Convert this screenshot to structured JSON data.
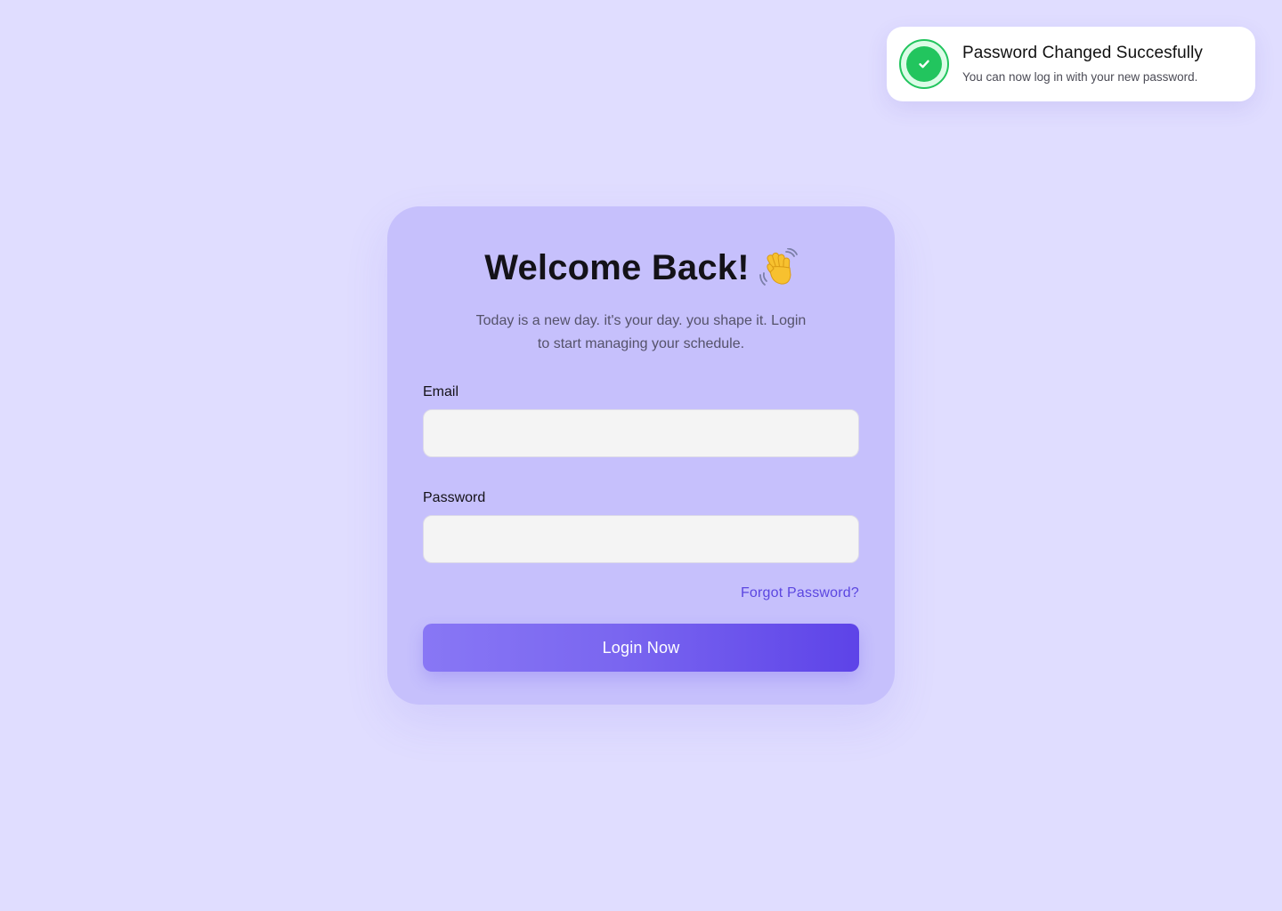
{
  "toast": {
    "icon": "check-icon",
    "title": "Password Changed Succesfully",
    "message": "You can now log in with your new password.",
    "status_color": "#22c55e"
  },
  "login": {
    "title": "Welcome Back!",
    "title_icon": "waving-hand-icon",
    "subtitle": "Today is a new day. it's your day. you shape it. Login to start managing your schedule.",
    "email": {
      "label": "Email",
      "value": "",
      "placeholder": ""
    },
    "password": {
      "label": "Password",
      "value": "",
      "placeholder": ""
    },
    "forgot_password": "Forgot Password?",
    "submit_label": "Login Now"
  },
  "colors": {
    "background": "#e0ddff",
    "card": "#c6c0fc",
    "accent": "#5b46e0",
    "button_gradient_start": "#8877f5",
    "button_gradient_end": "#5d43e8"
  }
}
